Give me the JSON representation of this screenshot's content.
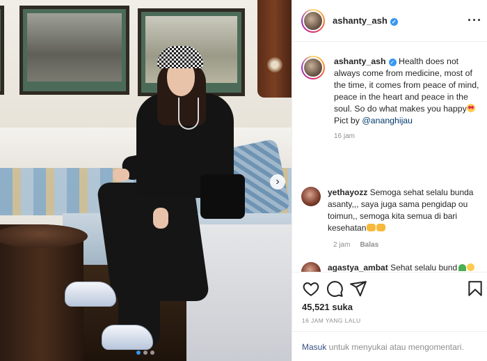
{
  "post": {
    "username": "ashanty_ash",
    "verified_mark": "✓",
    "more_glyph": "···",
    "next_arrow": "›",
    "caption_text": "Health does not always come from medicine, most of the time, it comes from peace of mind, peace in the heart and peace in the soul. So do what makes you happy",
    "caption_credit_prefix": "Pict by ",
    "caption_mention": "@ananghijau",
    "caption_time": "16 jam",
    "likes": "45,521 suka",
    "time_ago": "16 JAM YANG LALU",
    "carousel_count": 3,
    "carousel_active": 1
  },
  "comments": [
    {
      "username": "yethayozz",
      "text": "Semoga sehat selalu bunda asanty,,, saya juga sama pengidap ou toimun,, semoga kita semua di bari kesehatan",
      "time": "2 jam",
      "reply": "Balas"
    },
    {
      "username": "agastya_ambat",
      "text": "Sehat selalu bund"
    }
  ],
  "login_bar": {
    "link": "Masuk",
    "text": " untuk menyukai atau mengomentari."
  },
  "icons": [
    "heart-icon",
    "comment-icon",
    "share-icon",
    "bookmark-icon",
    "more-icon",
    "verified-icon",
    "chevron-right-icon"
  ],
  "colors": {
    "accent": "#3897f0",
    "link": "#00376b",
    "muted": "#8e8e8e",
    "text": "#262626"
  }
}
